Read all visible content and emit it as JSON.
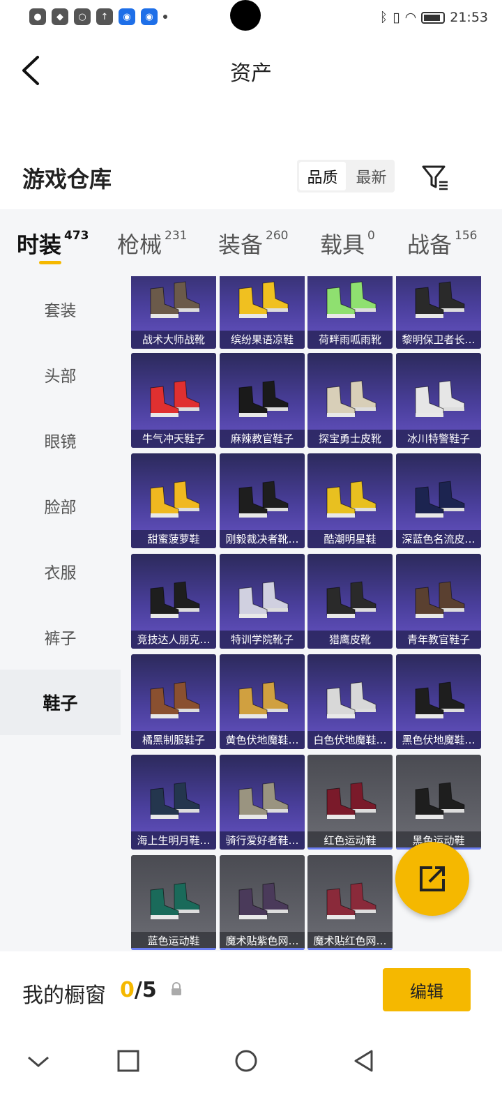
{
  "status_bar": {
    "time": "21:53"
  },
  "header": {
    "title": "资产"
  },
  "warehouse": {
    "title": "游戏仓库",
    "sort_options": [
      "品质",
      "最新"
    ]
  },
  "tabs": [
    {
      "label": "时装",
      "count": "473"
    },
    {
      "label": "枪械",
      "count": "231"
    },
    {
      "label": "装备",
      "count": "260"
    },
    {
      "label": "载具",
      "count": "0"
    },
    {
      "label": "战备",
      "count": "156"
    }
  ],
  "sidebar": [
    "套装",
    "头部",
    "眼镜",
    "脸部",
    "衣服",
    "裤子",
    "鞋子"
  ],
  "items": [
    {
      "name": "战术大师战靴",
      "rarity": "purple",
      "shoe_color": "#6b5a4a"
    },
    {
      "name": "缤纷果语凉鞋",
      "rarity": "purple",
      "shoe_color": "#f0c020"
    },
    {
      "name": "荷畔雨呱雨靴",
      "rarity": "purple",
      "shoe_color": "#8fe070"
    },
    {
      "name": "黎明保卫者长…",
      "rarity": "purple",
      "shoe_color": "#2a2a2a"
    },
    {
      "name": "牛气冲天鞋子",
      "rarity": "purple",
      "shoe_color": "#e03030"
    },
    {
      "name": "麻辣教官鞋子",
      "rarity": "purple",
      "shoe_color": "#1a1a1a"
    },
    {
      "name": "探宝勇士皮靴",
      "rarity": "purple",
      "shoe_color": "#d8cfb8"
    },
    {
      "name": "冰川特警鞋子",
      "rarity": "purple",
      "shoe_color": "#e6e6e6"
    },
    {
      "name": "甜蜜菠萝鞋",
      "rarity": "purple",
      "shoe_color": "#f0b820"
    },
    {
      "name": "刚毅裁决者靴…",
      "rarity": "purple",
      "shoe_color": "#1e1e1e"
    },
    {
      "name": "酷潮明星鞋",
      "rarity": "purple",
      "shoe_color": "#e8c020"
    },
    {
      "name": "深蓝色名流皮…",
      "rarity": "purple",
      "shoe_color": "#1c2450"
    },
    {
      "name": "竞技达人朋克…",
      "rarity": "purple",
      "shoe_color": "#1e1e1e"
    },
    {
      "name": "特训学院靴子",
      "rarity": "purple",
      "shoe_color": "#d0d0e0"
    },
    {
      "name": "猎鹰皮靴",
      "rarity": "purple",
      "shoe_color": "#2a2a2a"
    },
    {
      "name": "青年教官鞋子",
      "rarity": "purple",
      "shoe_color": "#5a4030"
    },
    {
      "name": "橘黑制服鞋子",
      "rarity": "purple",
      "shoe_color": "#8a5030"
    },
    {
      "name": "黄色伏地魔鞋…",
      "rarity": "purple",
      "shoe_color": "#d0a040"
    },
    {
      "name": "白色伏地魔鞋…",
      "rarity": "purple",
      "shoe_color": "#d8d8d8"
    },
    {
      "name": "黑色伏地魔鞋…",
      "rarity": "purple",
      "shoe_color": "#1e1e1e"
    },
    {
      "name": "海上生明月鞋…",
      "rarity": "purple",
      "shoe_color": "#24364e"
    },
    {
      "name": "骑行爱好者鞋…",
      "rarity": "purple",
      "shoe_color": "#9a9480"
    },
    {
      "name": "红色运动鞋",
      "rarity": "grey",
      "shoe_color": "#7a1a2a"
    },
    {
      "name": "黑色运动鞋",
      "rarity": "grey",
      "shoe_color": "#1e1e1e"
    },
    {
      "name": "蓝色运动鞋",
      "rarity": "grey",
      "shoe_color": "#1a6a5a"
    },
    {
      "name": "魔术贴紫色网…",
      "rarity": "grey",
      "shoe_color": "#4a3a5a"
    },
    {
      "name": "魔术贴红色网…",
      "rarity": "grey",
      "shoe_color": "#8a2a3a"
    }
  ],
  "showcase": {
    "label": "我的橱窗",
    "count": "0",
    "max": "/5",
    "edit_label": "编辑"
  },
  "colors": {
    "accent": "#f5b800",
    "card_purple": "#4a3f9c",
    "card_grey": "#5e5f66"
  }
}
